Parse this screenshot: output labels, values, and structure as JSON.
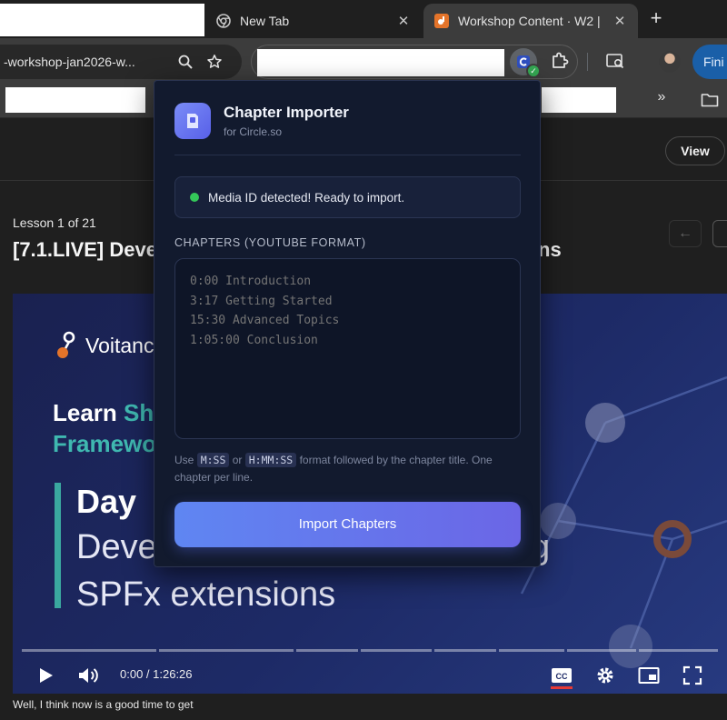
{
  "browser": {
    "tabs": [
      {
        "title": "New Tab",
        "icon": "chrome-icon"
      },
      {
        "title": "Workshop Content · W2 |",
        "icon": "circle-favicon-icon",
        "active": true
      }
    ],
    "url": "-workshop-jan2026-w...",
    "finish_label": "Fini",
    "bookmarks_more": "»"
  },
  "page": {
    "view_button": "View",
    "lesson_count": "Lesson 1 of 21",
    "lesson_title": "[7.1.LIVE] Deve",
    "lesson_title_tail": "ns",
    "prev_arrow": "←"
  },
  "video": {
    "brand": "Voitanc",
    "learn_prefix": "Learn ",
    "learn_highlight": "Sh",
    "framework": "Framewo",
    "day": "Day",
    "develop": "Deve",
    "develop_tail": "g",
    "spfx": "SPFx extensions",
    "time": "0:00 / 1:26:26",
    "caption": "Well, I think now is a good time to get"
  },
  "popup": {
    "title": "Chapter Importer",
    "subtitle": "for Circle.so",
    "status": "Media ID detected! Ready to import.",
    "status_color": "#34c759",
    "chapters_label": "CHAPTERS (YOUTUBE FORMAT)",
    "placeholder": "0:00 Introduction\n3:17 Getting Started\n15:30 Advanced Topics\n1:05:00 Conclusion",
    "hint_use": "Use",
    "hint_code1": "M:SS",
    "hint_or": "or",
    "hint_code2": "H:MM:SS",
    "hint_rest": "format followed by the chapter title. One chapter per line.",
    "import_label": "Import Chapters",
    "accent": "#6b66e6"
  }
}
